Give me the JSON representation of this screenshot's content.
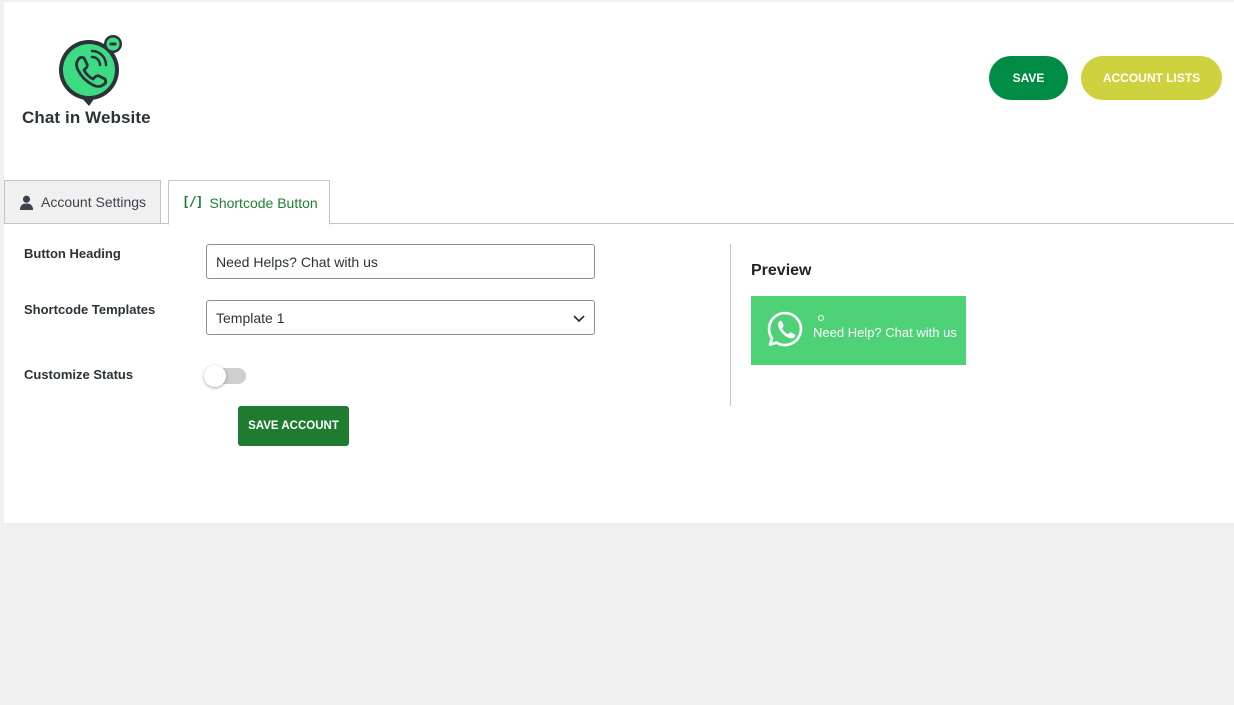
{
  "app": {
    "brand_name": "Chat in Website",
    "brand_color": "#008c45",
    "logo_icon": "whatsapp-phone-logo-icon"
  },
  "header": {
    "save_label": "SAVE",
    "account_lists_label": "ACCOUNT LISTS",
    "save_color": "#008c45",
    "account_lists_color": "#cdd23e"
  },
  "tabs": [
    {
      "label": "Account Settings",
      "icon": "user-icon",
      "active": false
    },
    {
      "label": "Shortcode Button",
      "icon": "shortcode-icon",
      "icon_text": "[/]",
      "active": true
    }
  ],
  "form": {
    "button_heading_label": "Button Heading",
    "button_heading_value": "Need Helps? Chat with us",
    "templates_label": "Shortcode Templates",
    "templates_selected": "Template 1",
    "customize_status_label": "Customize Status",
    "customize_status_on": false,
    "save_account_label": "SAVE ACCOUNT"
  },
  "preview": {
    "title": "Preview",
    "button_text": "Need Help? Chat with us",
    "button_color": "#4fd277",
    "icon": "whatsapp-icon"
  }
}
